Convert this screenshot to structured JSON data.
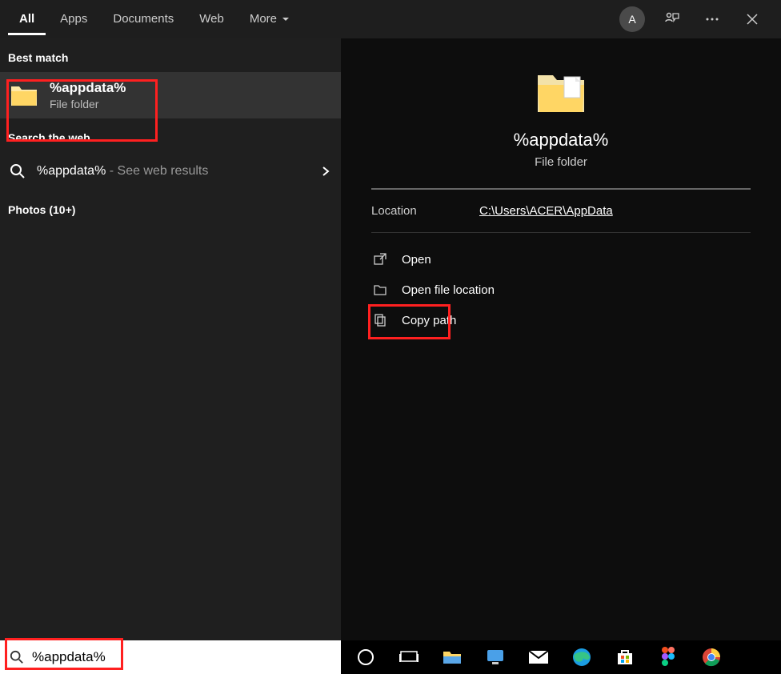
{
  "tabs": {
    "all": "All",
    "apps": "Apps",
    "documents": "Documents",
    "web": "Web",
    "more": "More"
  },
  "header": {
    "avatar_letter": "A"
  },
  "left": {
    "best_match": "Best match",
    "result": {
      "title": "%appdata%",
      "subtitle": "File folder"
    },
    "search_web": "Search the web",
    "web_query": "%appdata%",
    "web_hint": " - See web results",
    "photos": "Photos (10+)"
  },
  "preview": {
    "title": "%appdata%",
    "subtitle": "File folder",
    "location_label": "Location",
    "location_value": "C:\\Users\\ACER\\AppData",
    "actions": {
      "open": "Open",
      "open_loc": "Open file location",
      "copy_path": "Copy path"
    }
  },
  "search": {
    "value": "%appdata%"
  }
}
